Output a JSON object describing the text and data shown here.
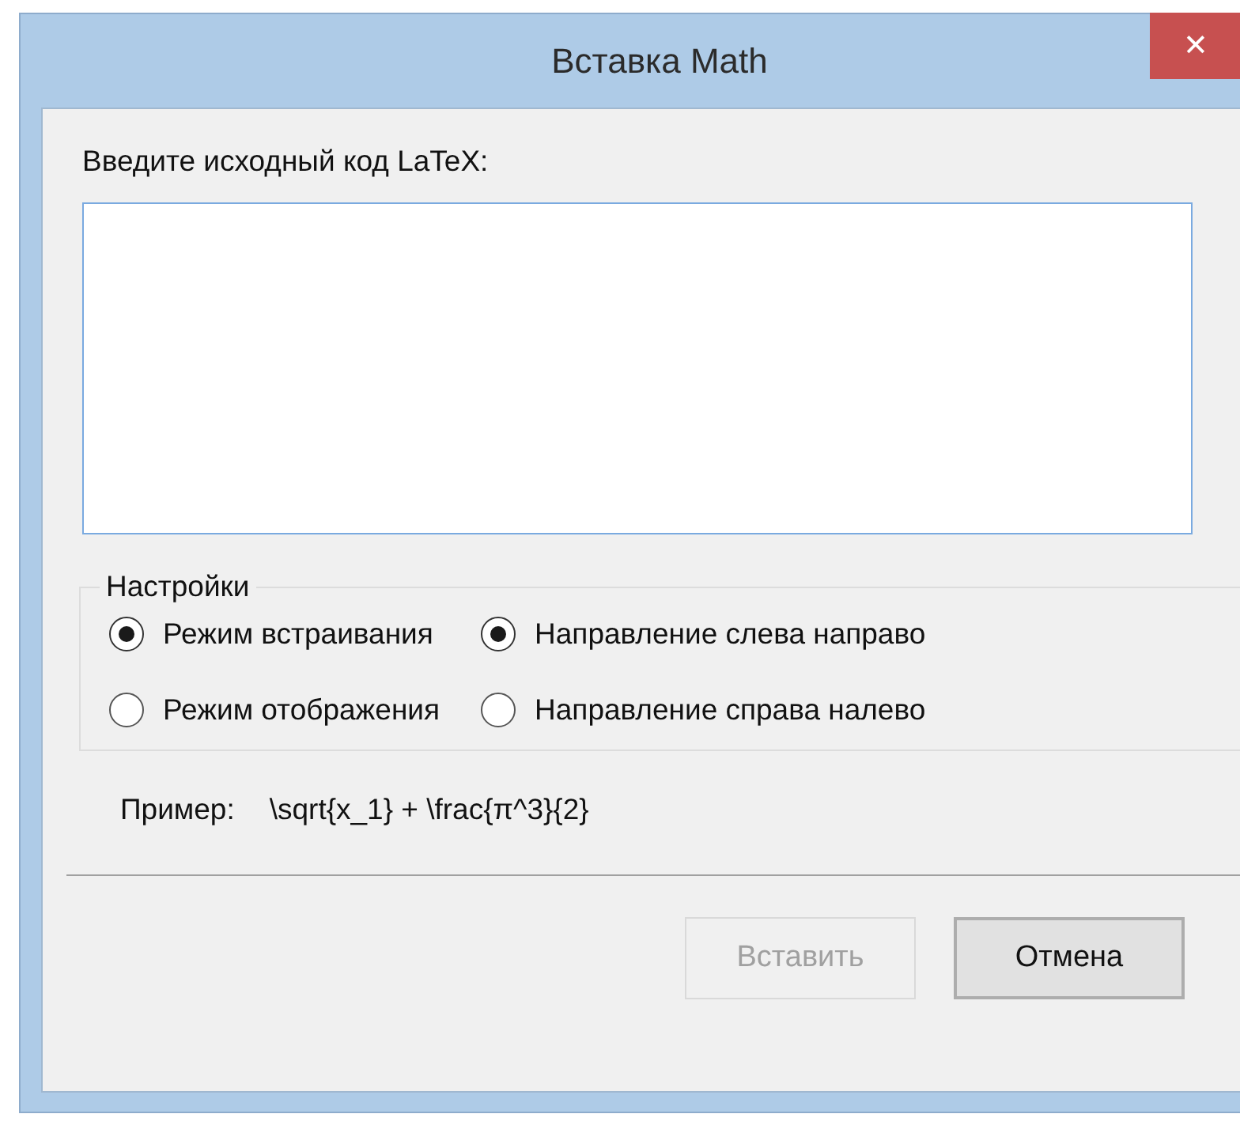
{
  "window": {
    "title": "Вставка Math",
    "close": "✕"
  },
  "source": {
    "label": "Введите исходный код LaTeX:"
  },
  "settings": {
    "title": "Настройки",
    "groups": [
      [
        {
          "label": "Режим встраивания",
          "selected": true
        },
        {
          "label": "Режим отображения",
          "selected": false
        }
      ],
      [
        {
          "label": "Направление слева направо",
          "selected": true
        },
        {
          "label": "Направление справа налево",
          "selected": false
        }
      ]
    ]
  },
  "example": {
    "label": "Пример:",
    "value": "\\sqrt{x_1} + \\frac{π^3}{2}"
  },
  "buttons": [
    {
      "label": "Вставить",
      "disabled": true
    },
    {
      "label": "Отмена",
      "disabled": false
    }
  ]
}
